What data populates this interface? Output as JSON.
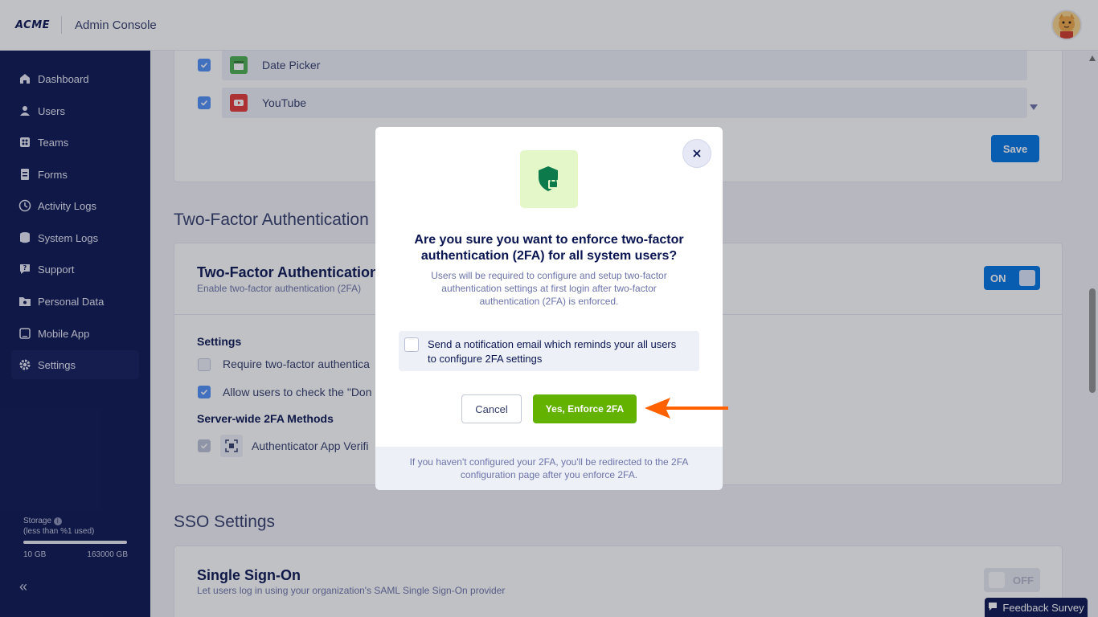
{
  "header": {
    "logo_text": "ACME",
    "app_title": "Admin Console",
    "avatar_icon": "cat-avatar-icon"
  },
  "sidebar": {
    "items": [
      {
        "label": "Dashboard",
        "icon": "home-icon"
      },
      {
        "label": "Users",
        "icon": "users-icon"
      },
      {
        "label": "Teams",
        "icon": "teams-icon"
      },
      {
        "label": "Forms",
        "icon": "forms-icon"
      },
      {
        "label": "Activity Logs",
        "icon": "clock-icon"
      },
      {
        "label": "System Logs",
        "icon": "database-icon"
      },
      {
        "label": "Support",
        "icon": "support-icon"
      },
      {
        "label": "Personal Data",
        "icon": "folder-icon"
      },
      {
        "label": "Mobile App",
        "icon": "mobile-icon"
      },
      {
        "label": "Settings",
        "icon": "gear-icon",
        "active": true
      }
    ],
    "storage": {
      "label": "Storage",
      "usage": "(less than %1 used)",
      "min": "10 GB",
      "max": "163000 GB"
    },
    "collapse_label": "«"
  },
  "integrations": {
    "items": [
      {
        "label": "Date Picker",
        "checked": true,
        "icon": "calendar-icon"
      },
      {
        "label": "YouTube",
        "checked": true,
        "icon": "youtube-icon"
      }
    ],
    "save_label": "Save"
  },
  "two_factor": {
    "section_title": "Two-Factor Authentication",
    "card_title": "Two-Factor Authentication",
    "card_sub": "Enable two-factor authentication (2FA)",
    "toggle_label": "ON",
    "settings_heading": "Settings",
    "options": [
      {
        "label": "Require two-factor authentica",
        "checked": false
      },
      {
        "label": "Allow users to check the \"Don",
        "checked": true
      }
    ],
    "methods_heading": "Server-wide 2FA Methods",
    "methods": [
      {
        "label": "Authenticator App Verifi",
        "checked": true
      }
    ]
  },
  "sso": {
    "section_title": "SSO Settings",
    "card_title": "Single Sign-On",
    "card_sub": "Let users log in using your organization's SAML Single Sign-On provider",
    "toggle_label": "OFF"
  },
  "feedback_label": "Feedback Survey",
  "modal": {
    "title": "Are you sure you want to enforce two-factor authentication (2FA) for all system users?",
    "description": "Users will be required to configure and setup two-factor authentication settings at first login after two-factor authentication (2FA) is enforced.",
    "notify_label": "Send a notification email which reminds your all users to configure 2FA settings",
    "notify_checked": false,
    "cancel_label": "Cancel",
    "confirm_label": "Yes, Enforce 2FA",
    "footer_text": "If you haven't configured your 2FA, you'll be redirected to the 2FA configuration page after you enforce 2FA.",
    "icon": "shield-lock-icon",
    "close_icon": "close-icon"
  },
  "colors": {
    "sidebar_bg": "#0a1551",
    "primary_blue": "#0075e3",
    "confirm_green": "#64b200",
    "arrow_orange": "#ff6100"
  }
}
